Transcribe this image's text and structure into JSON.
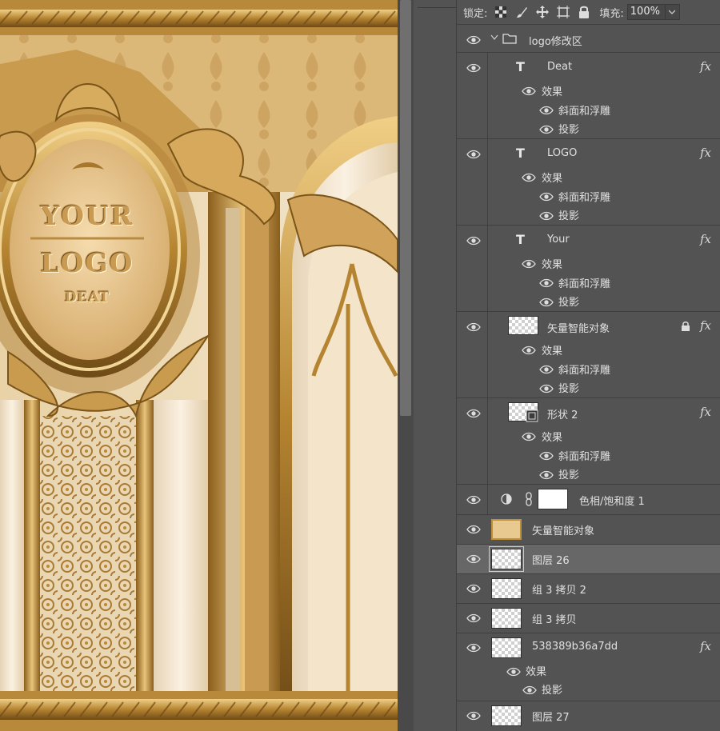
{
  "canvas": {
    "logo_line1": "YOUR",
    "logo_line2": "LOGO",
    "logo_line3": "DEAT",
    "colors": {
      "gold": "#c89a52",
      "gold_dark": "#7a5418",
      "cream": "#f1e4cc"
    }
  },
  "lock_bar": {
    "lock_label": "锁定:",
    "fill_label": "填充:",
    "fill_value": "100%"
  },
  "layers": {
    "group": {
      "name": "logo修改区"
    },
    "deat": {
      "name": "Deat",
      "effects": "效果",
      "bevel": "斜面和浮雕",
      "shadow": "投影",
      "fx": "fx"
    },
    "logo": {
      "name": "LOGO",
      "effects": "效果",
      "bevel": "斜面和浮雕",
      "shadow": "投影",
      "fx": "fx"
    },
    "your": {
      "name": "Your",
      "effects": "效果",
      "bevel": "斜面和浮雕",
      "shadow": "投影",
      "fx": "fx"
    },
    "vector1": {
      "name": "矢量智能对象",
      "effects": "效果",
      "bevel": "斜面和浮雕",
      "shadow": "投影",
      "fx": "fx"
    },
    "shape2": {
      "name": "形状 2",
      "effects": "效果",
      "bevel": "斜面和浮雕",
      "shadow": "投影",
      "fx": "fx"
    },
    "huesat": {
      "name": "色相/饱和度 1"
    },
    "vector2": {
      "name": "矢量智能对象"
    },
    "layer26": {
      "name": "图层 26"
    },
    "group3copy2": {
      "name": "组 3 拷贝 2"
    },
    "group3copy": {
      "name": "组 3 拷贝"
    },
    "hash": {
      "name": "538389b36a7dd",
      "effects": "效果",
      "shadow": "投影",
      "fx": "fx"
    },
    "layer27": {
      "name": "图层 27"
    }
  }
}
